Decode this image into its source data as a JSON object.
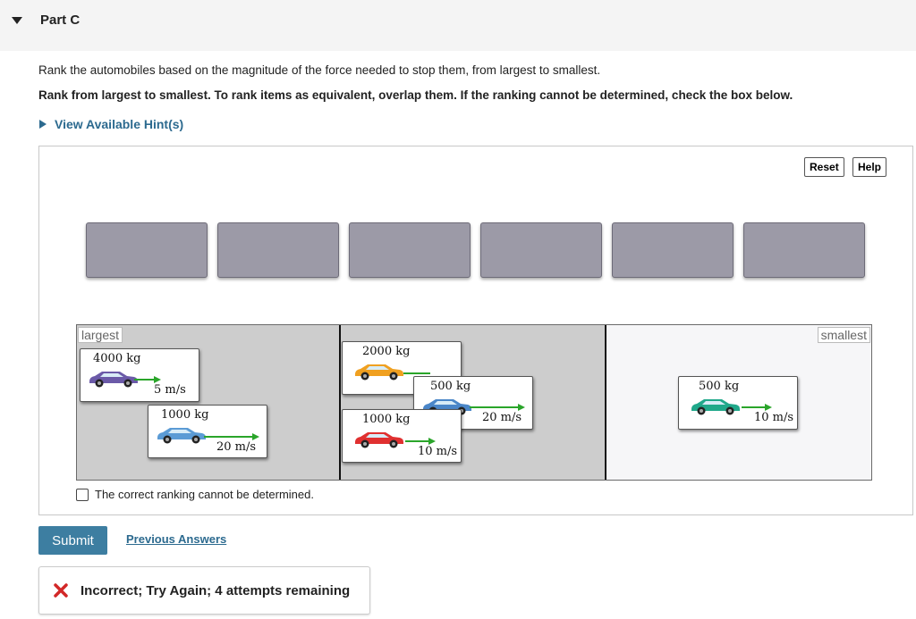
{
  "part": {
    "title": "Part C",
    "toggle_icon": "collapse-triangle-icon"
  },
  "question_text": "Rank the automobiles based on the magnitude of the force needed to stop them, from largest to smallest.",
  "instruction_text": "Rank from largest to smallest. To rank items as equivalent, overlap them. If the ranking cannot be determined, check the box below.",
  "hint_link": "View Available Hint(s)",
  "toolbar": {
    "reset_label": "Reset",
    "help_label": "Help"
  },
  "empty_slot_count_label": "",
  "ranking": {
    "largest_label": "largest",
    "smallest_label": "smallest",
    "cars": [
      {
        "mass": "4000 kg",
        "speed": "5 m/s",
        "color": "#6b5aa8"
      },
      {
        "mass": "1000 kg",
        "speed": "20 m/s",
        "color": "#5b9bd5"
      },
      {
        "mass": "2000 kg",
        "speed": "",
        "color": "#f0a020"
      },
      {
        "mass": "500 kg",
        "speed": "20 m/s",
        "color": "#4a86c8"
      },
      {
        "mass": "1000 kg",
        "speed": "10 m/s",
        "color": "#e03030"
      },
      {
        "mass": "500 kg",
        "speed": "10 m/s",
        "color": "#20a88a"
      }
    ],
    "arrow_color": "#2aa52a"
  },
  "cannot_determine_label": "The correct ranking cannot be determined.",
  "submit_label": "Submit",
  "previous_answers_label": "Previous Answers",
  "feedback": {
    "text": "Incorrect; Try Again; 4 attempts remaining",
    "icon": "x-icon",
    "icon_color": "#d22828"
  }
}
